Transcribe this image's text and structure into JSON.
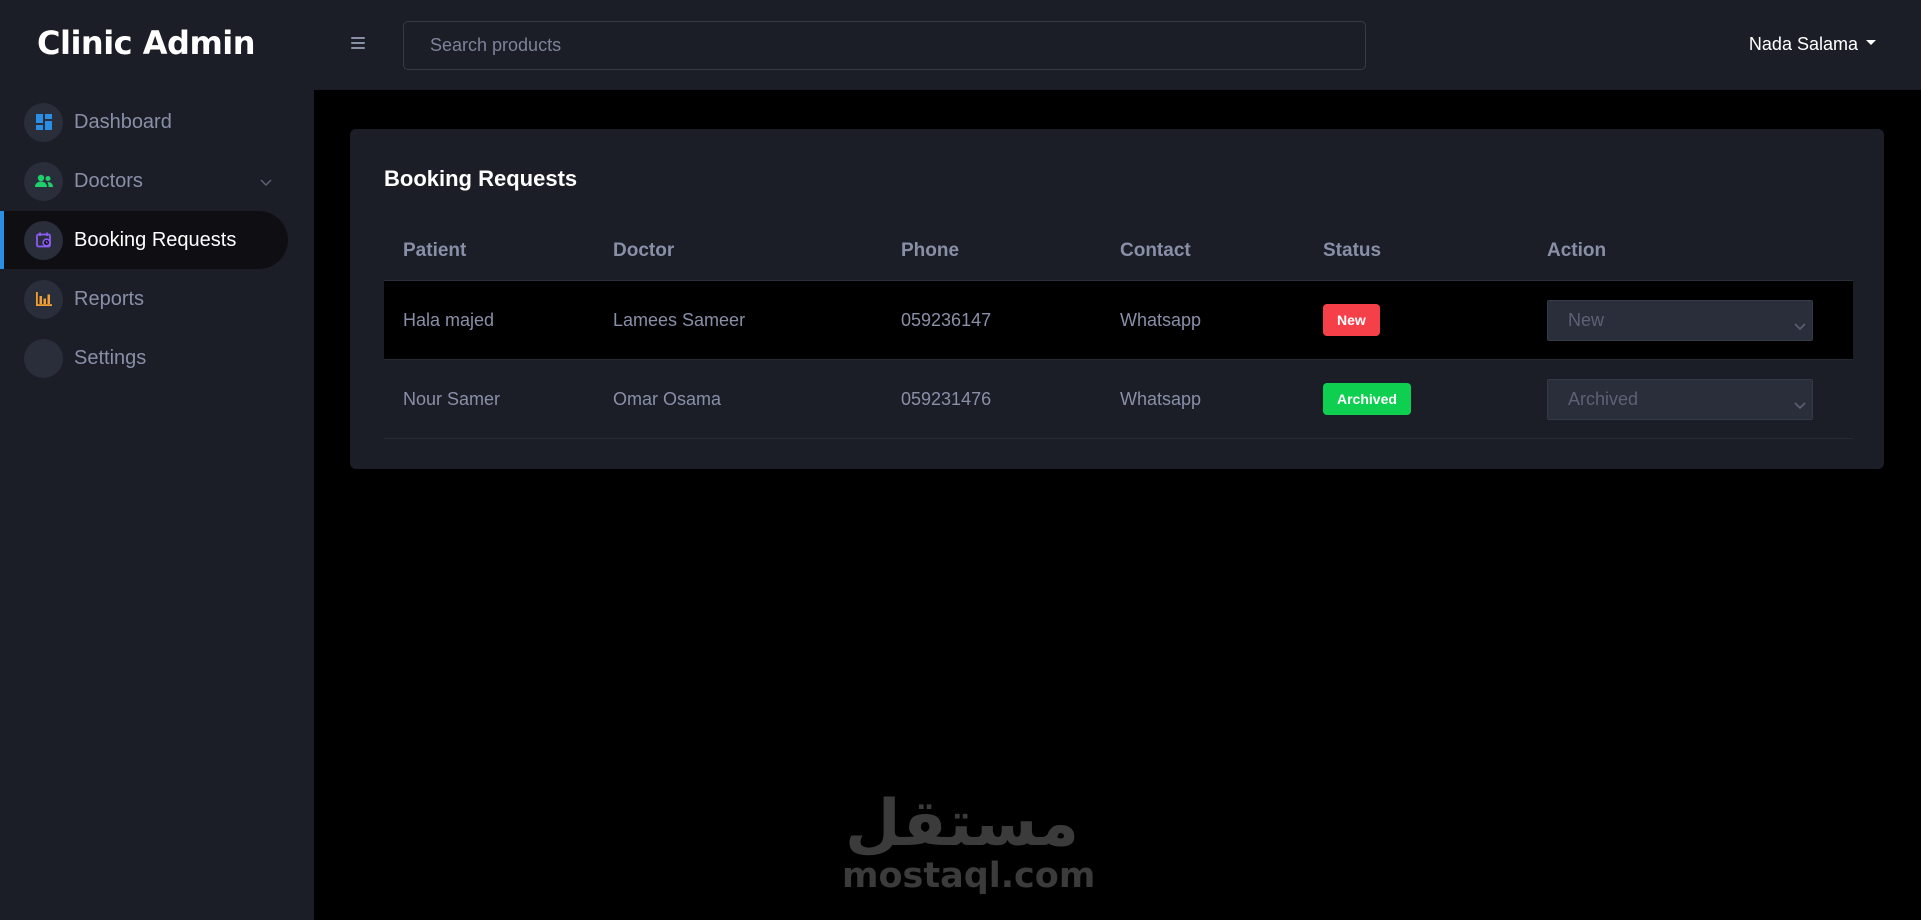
{
  "app": {
    "title": "Clinic Admin"
  },
  "sidebar": {
    "items": [
      {
        "label": "Dashboard",
        "icon": "dashboard-icon",
        "color": "#2a8fe4"
      },
      {
        "label": "Doctors",
        "icon": "users-icon",
        "color": "#1fcf6b",
        "has_submenu": true
      },
      {
        "label": "Booking Requests",
        "icon": "calendar-icon",
        "color": "#8b5cf6",
        "active": true
      },
      {
        "label": "Reports",
        "icon": "bar-chart-icon",
        "color": "#f0a030"
      },
      {
        "label": "Settings",
        "icon": "settings-icon",
        "color": "#2a2e3b"
      }
    ]
  },
  "header": {
    "search_placeholder": "Search products",
    "user_name": "Nada Salama"
  },
  "main": {
    "card_title": "Booking Requests",
    "columns": [
      "Patient",
      "Doctor",
      "Phone",
      "Contact",
      "Status",
      "Action"
    ],
    "rows": [
      {
        "patient": "Hala majed",
        "doctor": "Lamees Sameer",
        "phone": "059236147",
        "contact": "Whatsapp",
        "status": "New",
        "status_color": "#f5404a",
        "action": "New"
      },
      {
        "patient": "Nour Samer",
        "doctor": "Omar Osama",
        "phone": "059231476",
        "contact": "Whatsapp",
        "status": "Archived",
        "status_color": "#0ecf4f",
        "action": "Archived"
      }
    ]
  },
  "watermark": {
    "arabic": "مستقل",
    "latin": "mostaql.com"
  }
}
